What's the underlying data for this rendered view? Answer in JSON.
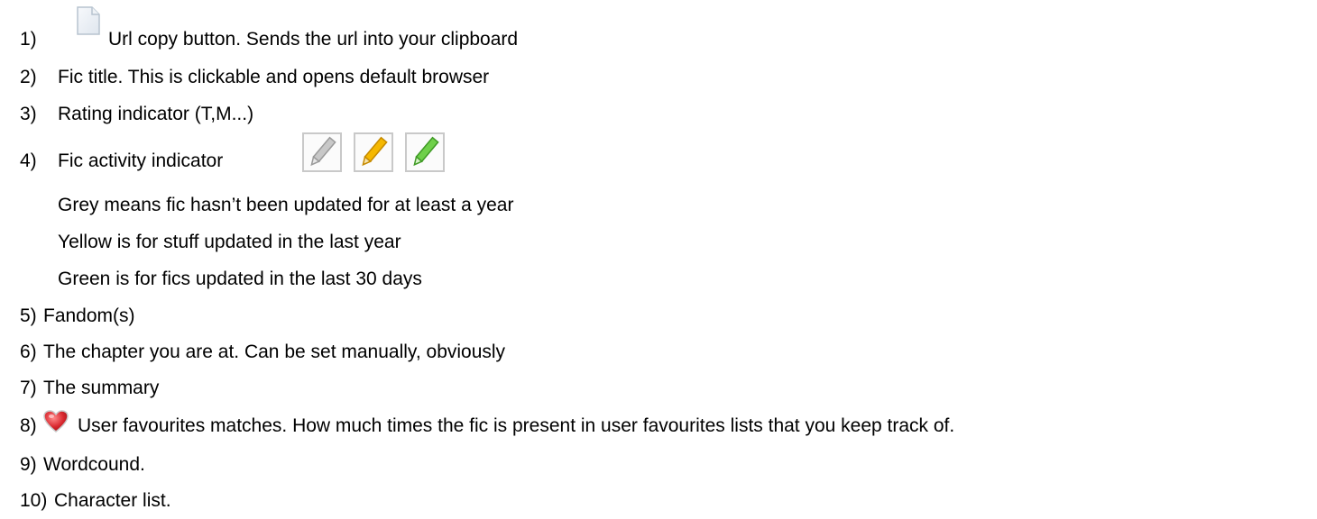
{
  "items": [
    {
      "num": "1)",
      "text": "Url copy button. Sends the url into your clipboard",
      "icon": "document-icon"
    },
    {
      "num": "2)",
      "text": "Fic title. This is clickable and opens default browser"
    },
    {
      "num": "3)",
      "text": "Rating indicator (T,M...)"
    },
    {
      "num": "4)",
      "text": "Fic activity indicator",
      "icons": [
        "grey-pencil-icon",
        "yellow-pencil-icon",
        "green-pencil-icon"
      ]
    },
    {
      "num": "",
      "text": "Grey means fic hasn’t been updated for at least a year"
    },
    {
      "num": "",
      "text": "Yellow is for stuff updated in the last year"
    },
    {
      "num": "",
      "text": "Green is for fics updated in the last 30 days"
    },
    {
      "num": "5)",
      "text": "Fandom(s)"
    },
    {
      "num": "6)",
      "text": "The chapter you are at. Can be set manually, obviously"
    },
    {
      "num": "7)",
      "text": "The summary"
    },
    {
      "num": "8)",
      "text": "User favourites matches. How much times the fic is present in user favourites lists that you keep track of.",
      "icon": "heart-icon"
    },
    {
      "num": "9)",
      "text": "Wordcound."
    },
    {
      "num": "10)",
      "text": "Character list."
    }
  ],
  "colors": {
    "grey": "#bdbdbd",
    "yellow": "#f5b800",
    "green": "#6fd04a",
    "heart": "#d9282f"
  }
}
